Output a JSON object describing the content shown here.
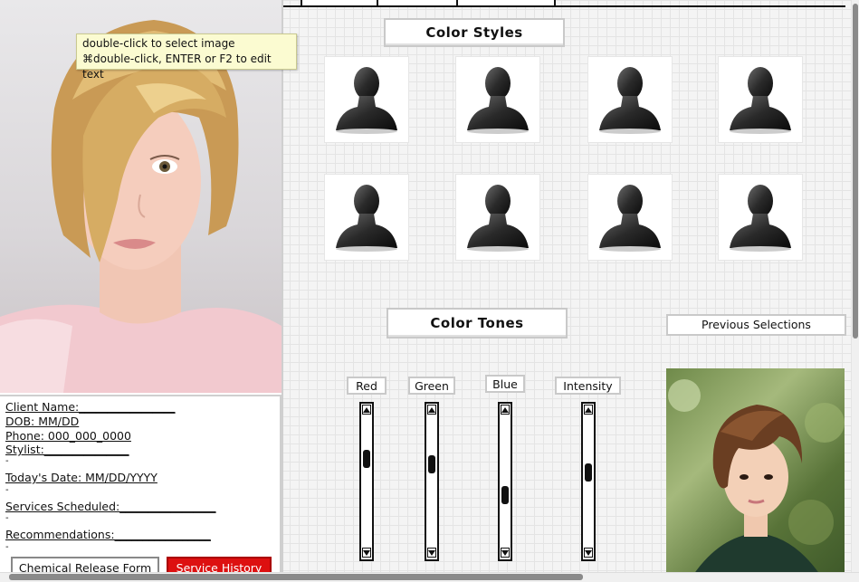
{
  "tooltip": {
    "line1": "double-click to select image",
    "line2": "⌘double-click, ENTER or F2 to edit text"
  },
  "client": {
    "name": "Client Name:_________________",
    "dob": "DOB: MM/DD",
    "phone": "Phone: 000_000_0000",
    "stylist": "Stylist:_______________",
    "today": "Today's Date: MM/DD/YYYY",
    "services": "Services Scheduled:_________________",
    "recommendations": "Recommendations:_________________",
    "tick": "-"
  },
  "buttons": {
    "chemical": "Chemical Release Form",
    "history": "Service History",
    "previous": "Previous Selections"
  },
  "sections": {
    "color_styles": "Color Styles",
    "color_tones": "Color Tones"
  },
  "sliders": [
    {
      "label": "Red",
      "value": 0.3
    },
    {
      "label": "Green",
      "value": 0.35
    },
    {
      "label": "Blue",
      "value": 0.62
    },
    {
      "label": "Intensity",
      "value": 0.42
    }
  ],
  "styles": {
    "count": 8,
    "icon": "user-silhouette-icon"
  },
  "colors": {
    "history_button": "#dd1010",
    "tooltip_bg": "#fbfbd1"
  }
}
